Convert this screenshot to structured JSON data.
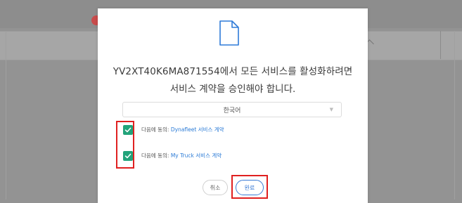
{
  "modal": {
    "message_line1": "YV2XT40K6MA871554에서 모든 서비스를 활성화하려면",
    "message_line2": "서비스 계약을 승인해야 합니다.",
    "language_select": {
      "selected": "한국어"
    },
    "agreements": [
      {
        "prefix": "다음에 동의:",
        "link_text": "Dynafleet 서비스 계약",
        "checked": true
      },
      {
        "prefix": "다음에 동의:",
        "link_text": "My Truck 서비스 계약",
        "checked": true
      }
    ],
    "buttons": {
      "cancel_label": "취소",
      "done_label": "완료"
    }
  },
  "colors": {
    "checkbox_green": "#22a37a",
    "link_blue": "#2b7bd6",
    "primary_button_blue": "#3a7bd5",
    "highlight_red": "#e02020",
    "overlay_gray": "#8d8d8d"
  },
  "icons": {
    "header": "document-icon",
    "select_caret": "chevron-down-icon",
    "checkbox_mark": "checkmark-icon"
  }
}
